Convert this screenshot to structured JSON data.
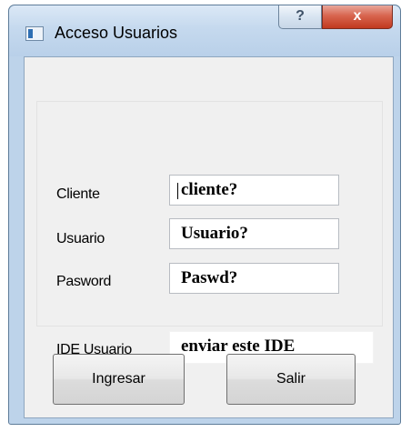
{
  "window": {
    "title": "Acceso Usuarios",
    "help_symbol": "?",
    "close_symbol": "x"
  },
  "form": {
    "cliente": {
      "label": "Cliente",
      "value": "cliente?"
    },
    "usuario": {
      "label": "Usuario",
      "value": "Usuario?"
    },
    "password": {
      "label": "Pasword",
      "value": "Paswd?"
    },
    "ide_usuario": {
      "label": "IDE Usuario",
      "value": "enviar este IDE"
    }
  },
  "buttons": {
    "ingresar": "Ingresar",
    "salir": "Salir"
  }
}
